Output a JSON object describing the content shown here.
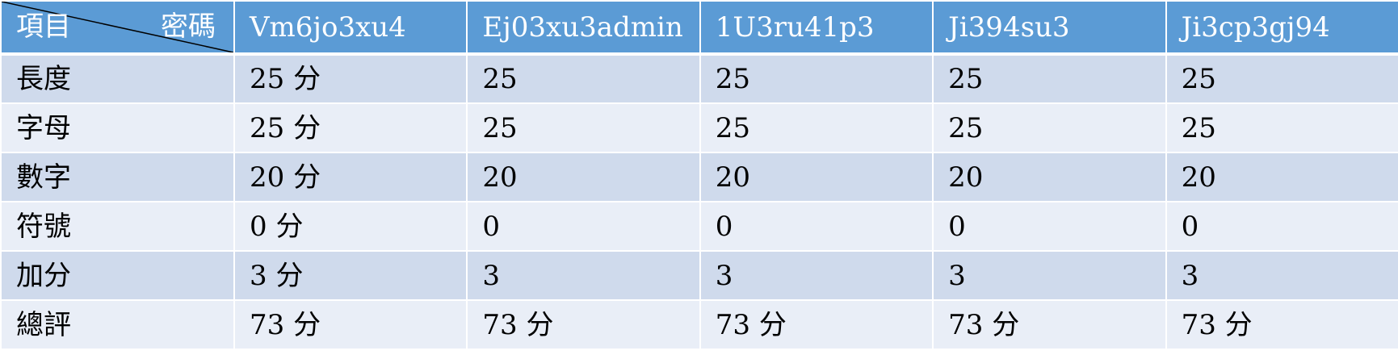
{
  "table": {
    "corner_row_label": "項目",
    "corner_col_label": "密碼",
    "columns": [
      "Vm6jo3xu4",
      "Ej03xu3admin",
      "1U3ru41p3",
      "Ji394su3",
      "Ji3cp3gj94"
    ],
    "rows": [
      {
        "label": "長度",
        "cells": [
          "25 分",
          "25",
          "25",
          "25",
          "25"
        ]
      },
      {
        "label": "字母",
        "cells": [
          "25 分",
          "25",
          "25",
          "25",
          "25"
        ]
      },
      {
        "label": "數字",
        "cells": [
          "20 分",
          "20",
          "20",
          "20",
          "20"
        ]
      },
      {
        "label": "符號",
        "cells": [
          "0 分",
          "0",
          "0",
          "0",
          "0"
        ]
      },
      {
        "label": "加分",
        "cells": [
          "3 分",
          "3",
          "3",
          "3",
          "3"
        ]
      },
      {
        "label": "總評",
        "cells": [
          "73 分",
          "73 分",
          "73 分",
          "73 分",
          "73 分"
        ]
      }
    ]
  },
  "colors": {
    "header": "#5b9bd5",
    "row_band_dark": "#cfdaec",
    "row_band_light": "#e9eef7"
  }
}
